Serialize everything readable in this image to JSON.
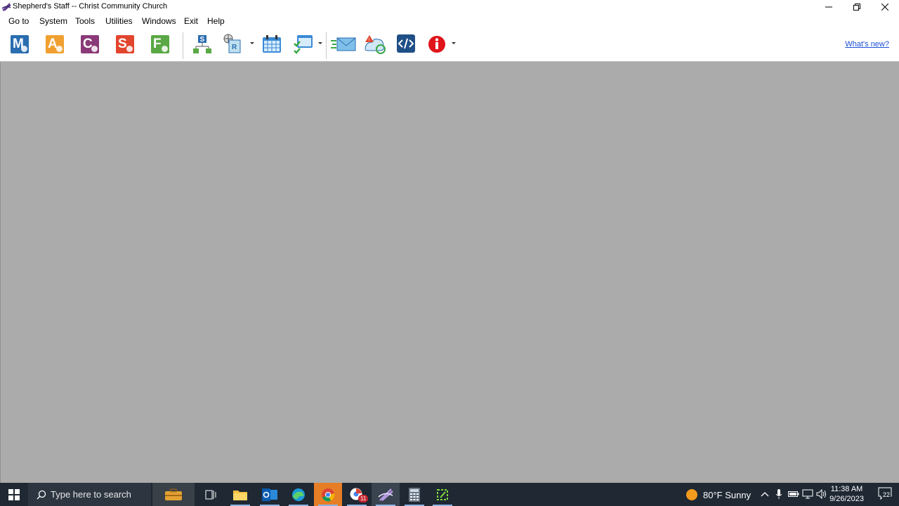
{
  "window": {
    "title": "Shepherd's Staff -- Christ Community Church",
    "minimize_label": "Minimize",
    "restore_label": "Restore",
    "close_label": "Close"
  },
  "menu": {
    "items": [
      "Go to",
      "System",
      "Tools",
      "Utilities",
      "Windows",
      "Exit",
      "Help"
    ]
  },
  "toolbar": {
    "modules": [
      {
        "letter": "M",
        "icon": "membership-module-icon",
        "color": "#2a6db0"
      },
      {
        "letter": "A",
        "icon": "attendance-module-icon",
        "color": "#f0a030"
      },
      {
        "letter": "C",
        "icon": "contributions-module-icon",
        "color": "#8a3a78"
      },
      {
        "letter": "S",
        "icon": "stewardship-module-icon",
        "color": "#e2452e"
      },
      {
        "letter": "F",
        "icon": "financial-module-icon",
        "color": "#5aa845"
      }
    ],
    "whats_new": "What's new?"
  },
  "taskbar": {
    "search_placeholder": "Type here to search",
    "chrome_badge": "11",
    "weather": "80°F  Sunny",
    "time": "11:38 AM",
    "date": "9/26/2023",
    "notifications_count": "22"
  },
  "colors": {
    "workspace": "#ababab",
    "taskbar": "#1f2833",
    "link": "#1a4fd6"
  }
}
